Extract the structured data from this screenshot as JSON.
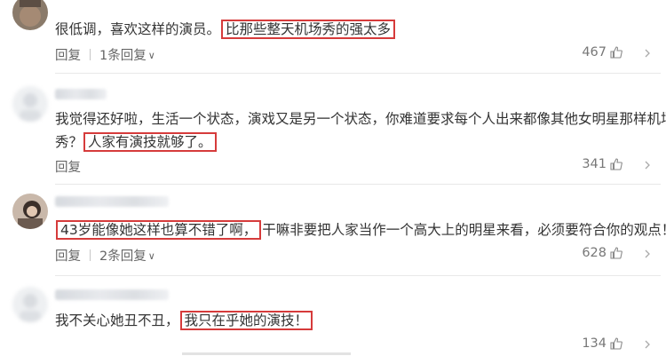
{
  "comments": [
    {
      "text_before": "很低调，喜欢这样的演员。",
      "highlight": "比那些整天机场秀的强太多",
      "text_after": "",
      "reply_label": "回复",
      "replies_label": "1条回复",
      "likes": "467"
    },
    {
      "line1": "我觉得还好啦，生活一个状态，演戏又是另一个状态，你难道要求每个人出来都像其他女明星那样机场",
      "text_before": "秀？",
      "highlight": "人家有演技就够了。",
      "text_after": "",
      "reply_label": "回复",
      "likes": "341"
    },
    {
      "text_before": "",
      "highlight": "43岁能像她这样也算不错了啊，",
      "text_after": "干嘛非要把人家当作一个高大上的明星来看，必须要符合你的观点！",
      "reply_label": "回复",
      "replies_label": "2条回复",
      "likes": "628"
    },
    {
      "text_before": "我不关心她丑不丑，",
      "highlight": "我只在乎她的演技！",
      "text_after": "",
      "likes": "134"
    }
  ],
  "colors": {
    "highlight_border": "#d63b3b",
    "text": "#333333",
    "meta": "#666666"
  },
  "icons": {
    "like": "thumbs-up-icon",
    "more": "chevron-right-icon",
    "expand": "chevron-down-icon"
  }
}
